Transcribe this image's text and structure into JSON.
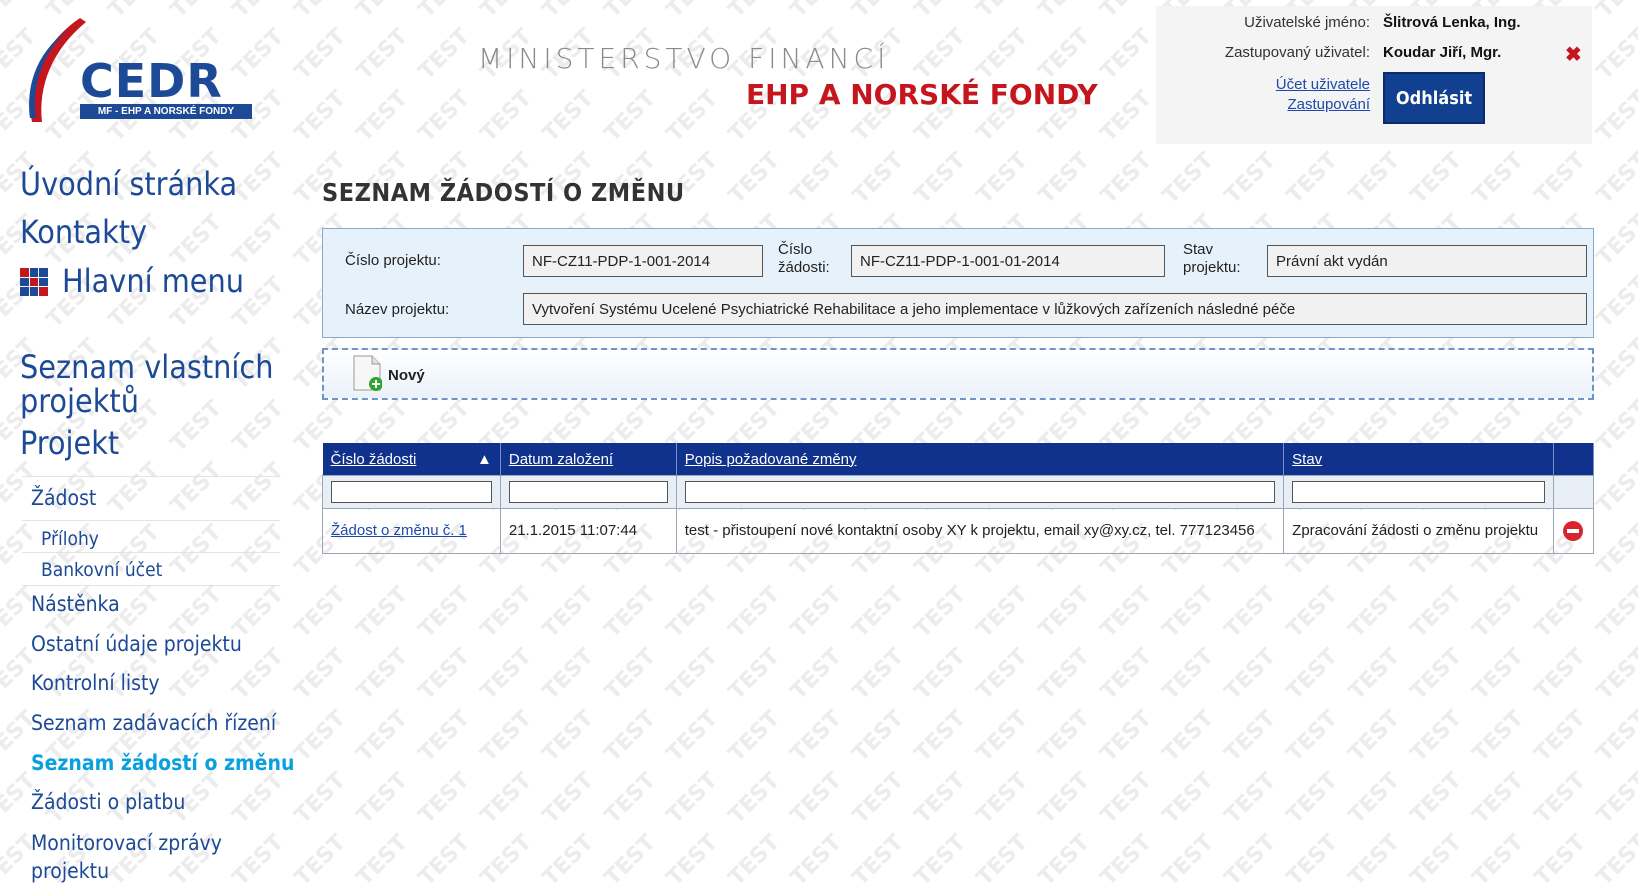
{
  "header": {
    "logo_text": "CEDR",
    "logo_sub": "MF - EHP A NORSKÉ FONDY",
    "ministry": "MINISTERSTVO FINANCÍ",
    "fund": "EHP A NORSKÉ FONDY"
  },
  "user": {
    "username_label": "Uživatelské jméno:",
    "username": "Šlitrová Lenka, Ing.",
    "represented_label": "Zastupovaný uživatel:",
    "represented": "Koudar Jiří, Mgr.",
    "account_link": "Účet uživatele",
    "representation_link": "Zastupování",
    "logout": "Odhlásit"
  },
  "sidebar": {
    "home": "Úvodní stránka",
    "contacts": "Kontakty",
    "main_menu": "Hlavní menu",
    "own_projects": [
      "Seznam vlastních",
      "projektů"
    ],
    "project": "Projekt",
    "request": "Žádost",
    "attachments": "Přílohy",
    "bank_account": "Bankovní účet",
    "board": "Nástěnka",
    "other_data": "Ostatní údaje projektu",
    "checklists": "Kontrolní listy",
    "tenders": "Seznam zadávacích řízení",
    "change_requests": "Seznam žádostí o změnu",
    "payment_requests": "Žádosti o platbu",
    "monitoring": [
      "Monitorovací zprávy",
      "projektu"
    ]
  },
  "page": {
    "title": "SEZNAM ŽÁDOSTÍ O ZMĚNU",
    "project_no_label": "Číslo projektu:",
    "project_no": "NF-CZ11-PDP-1-001-2014",
    "request_no_label": [
      "Číslo",
      "žádosti:"
    ],
    "request_no": "NF-CZ11-PDP-1-001-01-2014",
    "status_label": [
      "Stav",
      "projektu:"
    ],
    "status": "Právní akt vydán",
    "project_name_label": "Název projektu:",
    "project_name": "Vytvoření Systému Ucelené Psychiatrické Rehabilitace a jeho implementace v lůžkových zařízeních následné péče",
    "new_button": "Nový"
  },
  "table": {
    "columns": [
      "Číslo žádosti",
      "Datum založení",
      "Popis požadované změny",
      "Stav"
    ],
    "sort_indicator": "▲",
    "rows": [
      {
        "number": "Žádost o změnu č.  1",
        "date": "21.1.2015 11:07:44",
        "description": "test - přistoupení nové kontaktní osoby XY k projektu, email xy@xy.cz, tel. 777123456",
        "status": "Zpracování žádosti o změnu projektu"
      }
    ]
  },
  "colors": {
    "brand_blue": "#1d4a96",
    "header_blue": "#10328c",
    "accent_red": "#c4161c",
    "active_link": "#0aa0e0"
  },
  "watermark": "TEST"
}
